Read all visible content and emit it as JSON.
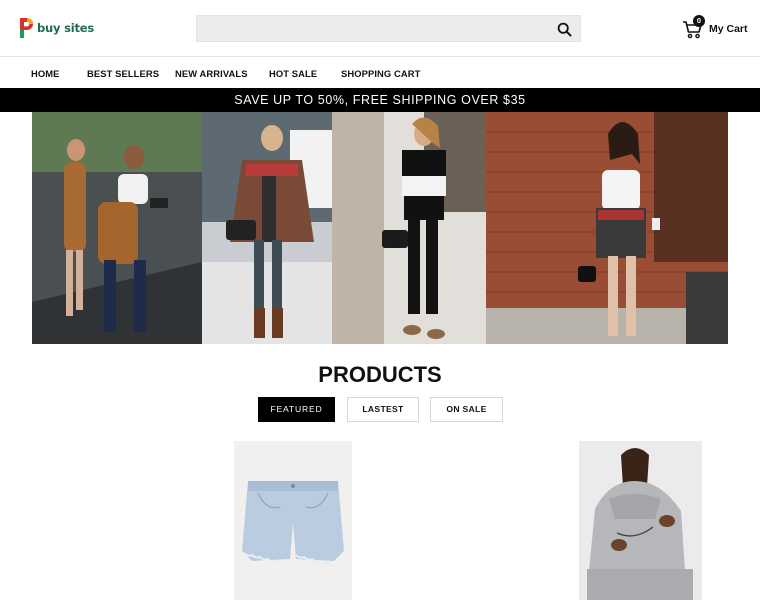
{
  "header": {
    "logo_text": "buy sites",
    "search": {
      "placeholder": "",
      "value": ""
    },
    "cart": {
      "count": "0",
      "label": "My Cart"
    }
  },
  "nav": {
    "items": [
      {
        "label": "HOME"
      },
      {
        "label": "BEST SELLERS"
      },
      {
        "label": "NEW ARRIVALS"
      },
      {
        "label": "HOT SALE"
      },
      {
        "label": "SHOPPING CART"
      }
    ]
  },
  "promo": {
    "text": "SAVE UP TO 50%, FREE SHIPPING OVER $35"
  },
  "products": {
    "title": "PRODUCTS",
    "tabs": [
      {
        "label": "FEATURED",
        "active": true
      },
      {
        "label": "LASTEST",
        "active": false
      },
      {
        "label": "ON SALE",
        "active": false
      }
    ]
  },
  "colors": {
    "brand_green": "#1f6d4e",
    "brand_red": "#d0342c",
    "accent_black": "#000000"
  }
}
